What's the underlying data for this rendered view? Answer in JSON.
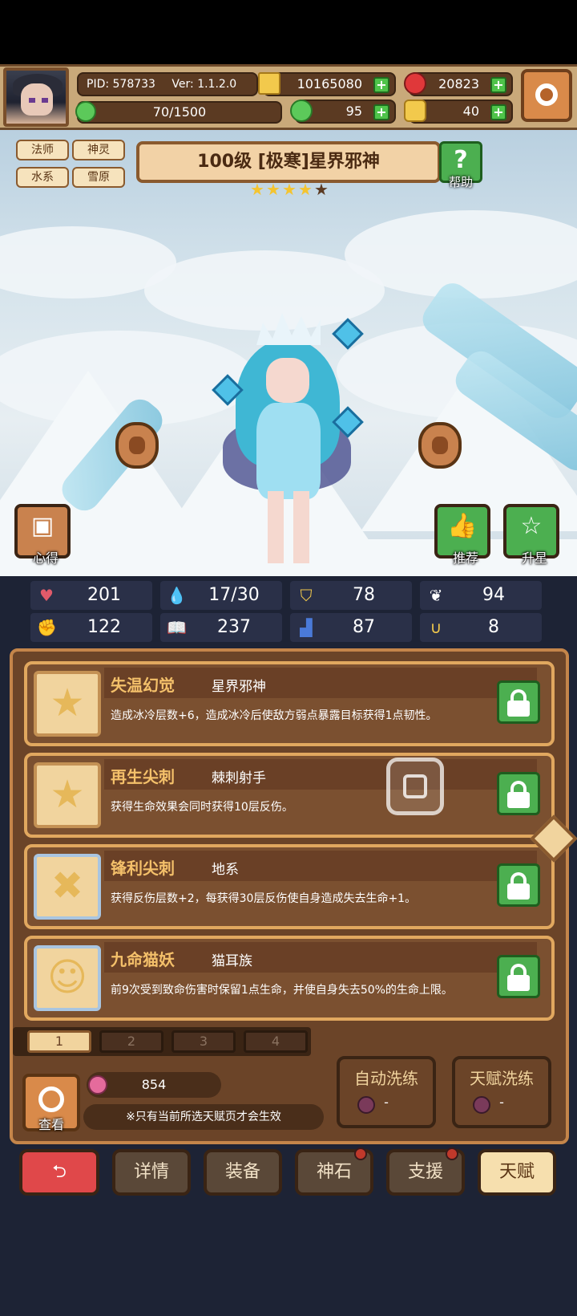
{
  "header": {
    "pid": "PID: 578733",
    "version": "Ver: 1.1.2.0",
    "gold": "10165080",
    "ruby": "20823",
    "energy": "70/1500",
    "energy_fraction": 0.047,
    "clover": "95",
    "shoes": "40"
  },
  "character": {
    "tags": [
      "法师",
      "神灵",
      "水系",
      "雪原"
    ],
    "title": "100级  [极寒]星界邪神",
    "stars_filled": 4,
    "stars_total": 5,
    "help_label": "帮助",
    "left_button": "心得",
    "recommend_button": "推荐",
    "upgrade_button": "升星"
  },
  "stats": [
    {
      "icon": "heart-icon",
      "value": "201"
    },
    {
      "icon": "water-drop-icon",
      "value": "17/30"
    },
    {
      "icon": "shield-icon",
      "value": "78"
    },
    {
      "icon": "wing-icon",
      "value": "94"
    },
    {
      "icon": "fist-icon",
      "value": "122"
    },
    {
      "icon": "book-icon",
      "value": "237"
    },
    {
      "icon": "boot-icon",
      "value": "87"
    },
    {
      "icon": "horseshoe-icon",
      "value": "8"
    }
  ],
  "talents": [
    {
      "name": "失温幻觉",
      "source": "星界邪神",
      "desc": "造成冰冷层数+6，造成冰冷后使敌方弱点暴露目标获得1点韧性。"
    },
    {
      "name": "再生尖刺",
      "source": "棘刺射手",
      "desc": "获得生命效果会同时获得10层反伤。"
    },
    {
      "name": "锋利尖刺",
      "source": "地系",
      "desc": "获得反伤层数+2，每获得30层反伤使自身造成失去生命+1。"
    },
    {
      "name": "九命猫妖",
      "source": "猫耳族",
      "desc": "前9次受到致命伤害时保留1点生命，并使自身失去50%的生命上限。"
    }
  ],
  "pages": [
    "1",
    "2",
    "3",
    "4"
  ],
  "bottom": {
    "view_label": "查看",
    "peach_count": "854",
    "note": "※只有当前所选天赋页才会生效",
    "auto_refine": "自动洗练",
    "auto_refine_cost": "-",
    "talent_refine": "天赋洗练",
    "talent_refine_cost": "-"
  },
  "nav": {
    "back": "⮌",
    "details": "详情",
    "equipment": "装备",
    "godstone": "神石",
    "support": "支援",
    "talent": "天赋"
  }
}
